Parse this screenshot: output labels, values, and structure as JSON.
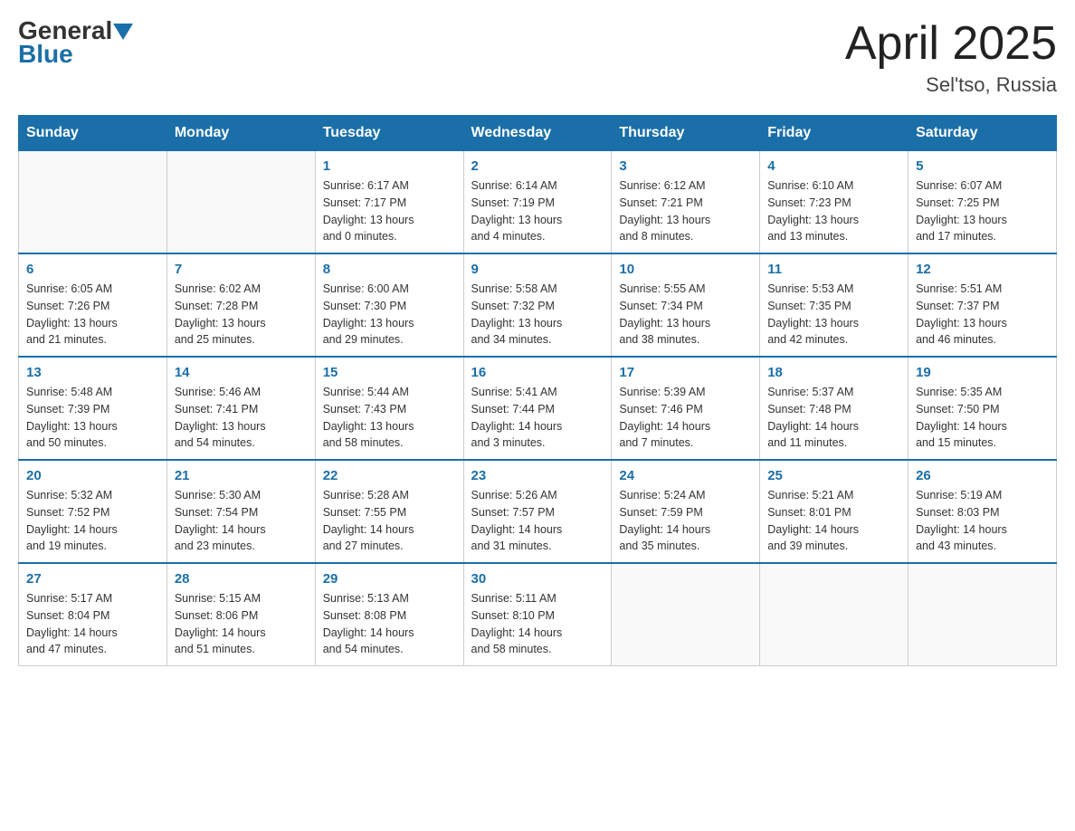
{
  "logo": {
    "part1": "General",
    "part2": "Blue"
  },
  "header": {
    "month_year": "April 2025",
    "location": "Sel'tso, Russia"
  },
  "weekdays": [
    "Sunday",
    "Monday",
    "Tuesday",
    "Wednesday",
    "Thursday",
    "Friday",
    "Saturday"
  ],
  "weeks": [
    [
      {
        "day": "",
        "info": ""
      },
      {
        "day": "",
        "info": ""
      },
      {
        "day": "1",
        "info": "Sunrise: 6:17 AM\nSunset: 7:17 PM\nDaylight: 13 hours\nand 0 minutes."
      },
      {
        "day": "2",
        "info": "Sunrise: 6:14 AM\nSunset: 7:19 PM\nDaylight: 13 hours\nand 4 minutes."
      },
      {
        "day": "3",
        "info": "Sunrise: 6:12 AM\nSunset: 7:21 PM\nDaylight: 13 hours\nand 8 minutes."
      },
      {
        "day": "4",
        "info": "Sunrise: 6:10 AM\nSunset: 7:23 PM\nDaylight: 13 hours\nand 13 minutes."
      },
      {
        "day": "5",
        "info": "Sunrise: 6:07 AM\nSunset: 7:25 PM\nDaylight: 13 hours\nand 17 minutes."
      }
    ],
    [
      {
        "day": "6",
        "info": "Sunrise: 6:05 AM\nSunset: 7:26 PM\nDaylight: 13 hours\nand 21 minutes."
      },
      {
        "day": "7",
        "info": "Sunrise: 6:02 AM\nSunset: 7:28 PM\nDaylight: 13 hours\nand 25 minutes."
      },
      {
        "day": "8",
        "info": "Sunrise: 6:00 AM\nSunset: 7:30 PM\nDaylight: 13 hours\nand 29 minutes."
      },
      {
        "day": "9",
        "info": "Sunrise: 5:58 AM\nSunset: 7:32 PM\nDaylight: 13 hours\nand 34 minutes."
      },
      {
        "day": "10",
        "info": "Sunrise: 5:55 AM\nSunset: 7:34 PM\nDaylight: 13 hours\nand 38 minutes."
      },
      {
        "day": "11",
        "info": "Sunrise: 5:53 AM\nSunset: 7:35 PM\nDaylight: 13 hours\nand 42 minutes."
      },
      {
        "day": "12",
        "info": "Sunrise: 5:51 AM\nSunset: 7:37 PM\nDaylight: 13 hours\nand 46 minutes."
      }
    ],
    [
      {
        "day": "13",
        "info": "Sunrise: 5:48 AM\nSunset: 7:39 PM\nDaylight: 13 hours\nand 50 minutes."
      },
      {
        "day": "14",
        "info": "Sunrise: 5:46 AM\nSunset: 7:41 PM\nDaylight: 13 hours\nand 54 minutes."
      },
      {
        "day": "15",
        "info": "Sunrise: 5:44 AM\nSunset: 7:43 PM\nDaylight: 13 hours\nand 58 minutes."
      },
      {
        "day": "16",
        "info": "Sunrise: 5:41 AM\nSunset: 7:44 PM\nDaylight: 14 hours\nand 3 minutes."
      },
      {
        "day": "17",
        "info": "Sunrise: 5:39 AM\nSunset: 7:46 PM\nDaylight: 14 hours\nand 7 minutes."
      },
      {
        "day": "18",
        "info": "Sunrise: 5:37 AM\nSunset: 7:48 PM\nDaylight: 14 hours\nand 11 minutes."
      },
      {
        "day": "19",
        "info": "Sunrise: 5:35 AM\nSunset: 7:50 PM\nDaylight: 14 hours\nand 15 minutes."
      }
    ],
    [
      {
        "day": "20",
        "info": "Sunrise: 5:32 AM\nSunset: 7:52 PM\nDaylight: 14 hours\nand 19 minutes."
      },
      {
        "day": "21",
        "info": "Sunrise: 5:30 AM\nSunset: 7:54 PM\nDaylight: 14 hours\nand 23 minutes."
      },
      {
        "day": "22",
        "info": "Sunrise: 5:28 AM\nSunset: 7:55 PM\nDaylight: 14 hours\nand 27 minutes."
      },
      {
        "day": "23",
        "info": "Sunrise: 5:26 AM\nSunset: 7:57 PM\nDaylight: 14 hours\nand 31 minutes."
      },
      {
        "day": "24",
        "info": "Sunrise: 5:24 AM\nSunset: 7:59 PM\nDaylight: 14 hours\nand 35 minutes."
      },
      {
        "day": "25",
        "info": "Sunrise: 5:21 AM\nSunset: 8:01 PM\nDaylight: 14 hours\nand 39 minutes."
      },
      {
        "day": "26",
        "info": "Sunrise: 5:19 AM\nSunset: 8:03 PM\nDaylight: 14 hours\nand 43 minutes."
      }
    ],
    [
      {
        "day": "27",
        "info": "Sunrise: 5:17 AM\nSunset: 8:04 PM\nDaylight: 14 hours\nand 47 minutes."
      },
      {
        "day": "28",
        "info": "Sunrise: 5:15 AM\nSunset: 8:06 PM\nDaylight: 14 hours\nand 51 minutes."
      },
      {
        "day": "29",
        "info": "Sunrise: 5:13 AM\nSunset: 8:08 PM\nDaylight: 14 hours\nand 54 minutes."
      },
      {
        "day": "30",
        "info": "Sunrise: 5:11 AM\nSunset: 8:10 PM\nDaylight: 14 hours\nand 58 minutes."
      },
      {
        "day": "",
        "info": ""
      },
      {
        "day": "",
        "info": ""
      },
      {
        "day": "",
        "info": ""
      }
    ]
  ]
}
